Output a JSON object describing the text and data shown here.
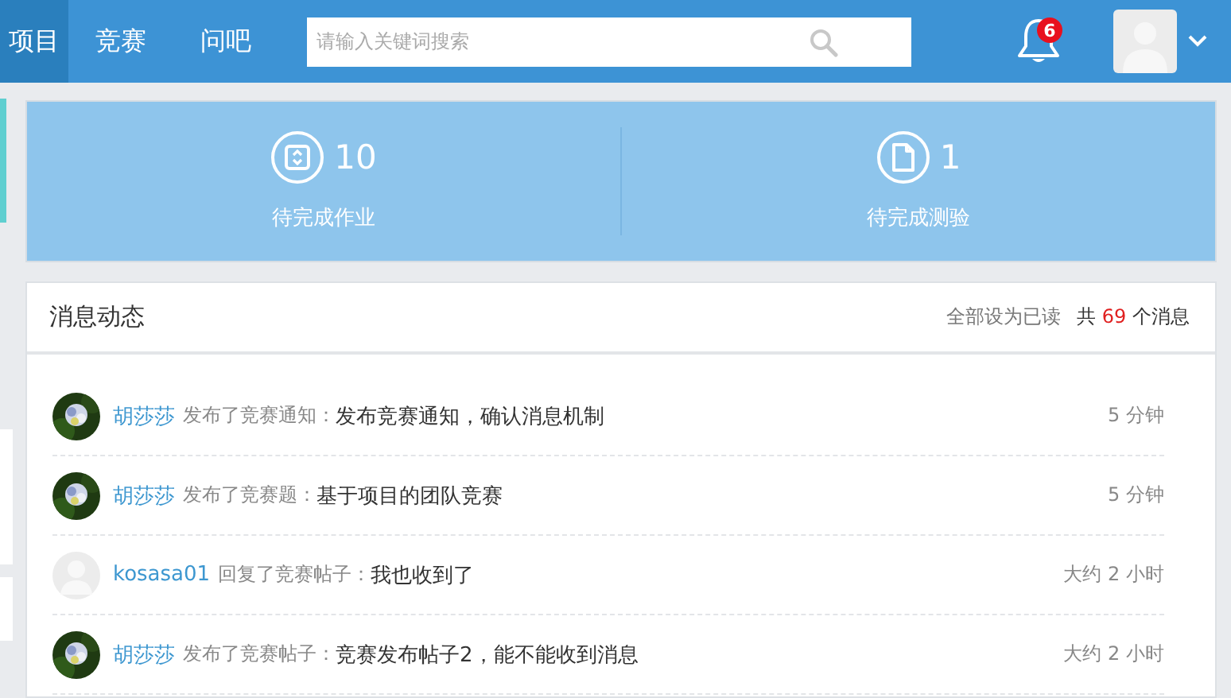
{
  "nav": [
    {
      "label": "项目",
      "selected": true
    },
    {
      "label": "竞赛",
      "selected": false
    },
    {
      "label": "问吧",
      "selected": false
    }
  ],
  "search": {
    "placeholder": "请输入关键词搜索"
  },
  "notifications": {
    "badge": "6"
  },
  "stats": [
    {
      "kind": "assignment",
      "value": "10",
      "label": "待完成作业"
    },
    {
      "kind": "quiz",
      "value": "1",
      "label": "待完成测验"
    }
  ],
  "messages": {
    "title": "消息动态",
    "mark_all_read": "全部设为已读",
    "total_prefix": "共",
    "total_count": "69",
    "total_suffix": "个消息",
    "items": [
      {
        "kind": "picture",
        "user": "胡莎莎",
        "action": "发布了竞赛通知：",
        "content": "发布竞赛通知，确认消息机制",
        "time": "5 分钟"
      },
      {
        "kind": "picture",
        "user": "胡莎莎",
        "action": "发布了竞赛题：",
        "content": "基于项目的团队竞赛",
        "time": "5 分钟"
      },
      {
        "kind": "default",
        "user": "kosasa01",
        "action": "回复了竞赛帖子：",
        "content": "我也收到了",
        "time": "大约 2 小时"
      },
      {
        "kind": "picture",
        "user": "胡莎莎",
        "action": "发布了竞赛帖子：",
        "content": "竞赛发布帖子2，能不能收到消息",
        "time": "大约 2 小时"
      }
    ]
  }
}
